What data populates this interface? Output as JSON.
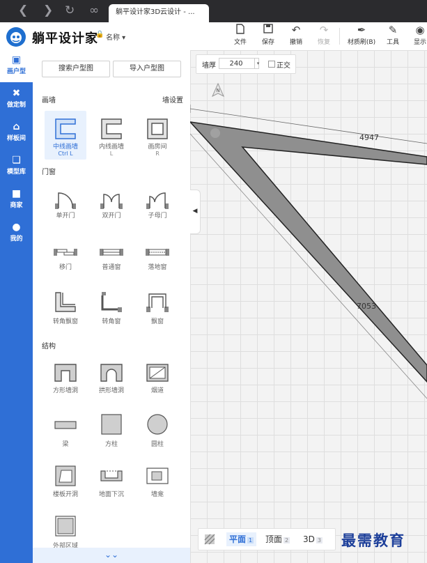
{
  "browser": {
    "tab_title": "躺平设计家3D云设计 - ...",
    "nav_icons": [
      "back-icon",
      "forward-icon",
      "reload-icon",
      "link-icon"
    ]
  },
  "header": {
    "logo_text": "躺平设计家",
    "doc_name": "名称 ▾",
    "tools": [
      {
        "label": "文件",
        "icon": "file-icon"
      },
      {
        "label": "保存",
        "icon": "save-icon"
      },
      {
        "label": "撤销",
        "icon": "undo-icon"
      },
      {
        "label": "恢复",
        "icon": "redo-icon",
        "disabled": true
      },
      {
        "label": "材质刷(B)",
        "icon": "material-brush-icon"
      },
      {
        "label": "工具",
        "icon": "tools-icon"
      },
      {
        "label": "显示",
        "icon": "eye-icon"
      }
    ]
  },
  "sidebar": {
    "items": [
      {
        "label": "画户型",
        "icon": "floorplan-icon",
        "active": true
      },
      {
        "label": "做定制",
        "icon": "customize-icon"
      },
      {
        "label": "样板间",
        "icon": "home-icon"
      },
      {
        "label": "模型库",
        "icon": "cube-icon"
      },
      {
        "label": "商家",
        "icon": "shop-icon"
      },
      {
        "label": "我的",
        "icon": "user-icon"
      }
    ]
  },
  "panel": {
    "search_button": "搜索户型图",
    "import_button": "导入户型图",
    "wall_section": "画墙",
    "wall_settings": "墙设置",
    "walls": [
      {
        "label": "中线画墙",
        "shortcut": "Ctrl L",
        "icon": "centerline-wall-icon",
        "selected": true
      },
      {
        "label": "内线画墙",
        "shortcut": "L",
        "icon": "innerline-wall-icon"
      },
      {
        "label": "画房间",
        "shortcut": "R",
        "icon": "draw-room-icon"
      }
    ],
    "door_section": "门窗",
    "doors": [
      {
        "label": "单开门",
        "icon": "single-door-icon"
      },
      {
        "label": "双开门",
        "icon": "double-door-icon"
      },
      {
        "label": "子母门",
        "icon": "mother-child-door-icon"
      },
      {
        "label": "移门",
        "icon": "sliding-door-icon"
      },
      {
        "label": "普通窗",
        "icon": "window-icon"
      },
      {
        "label": "落地窗",
        "icon": "french-window-icon"
      },
      {
        "label": "转角飘窗",
        "icon": "corner-bay-window-icon"
      },
      {
        "label": "转角窗",
        "icon": "corner-window-icon"
      },
      {
        "label": "飘窗",
        "icon": "bay-window-icon"
      }
    ],
    "structure_section": "结构",
    "structures": [
      {
        "label": "方形墙洞",
        "icon": "square-opening-icon"
      },
      {
        "label": "拱形墙洞",
        "icon": "arch-opening-icon"
      },
      {
        "label": "烟道",
        "icon": "flue-icon"
      },
      {
        "label": "梁",
        "icon": "beam-icon"
      },
      {
        "label": "方柱",
        "icon": "square-column-icon"
      },
      {
        "label": "圆柱",
        "icon": "round-column-icon"
      },
      {
        "label": "楼板开洞",
        "icon": "floor-opening-icon"
      },
      {
        "label": "地面下沉",
        "icon": "floor-sink-icon"
      },
      {
        "label": "墙龛",
        "icon": "niche-icon"
      },
      {
        "label": "外部区域",
        "icon": "outer-area-icon"
      }
    ]
  },
  "canvas": {
    "thickness_label": "墙厚",
    "thickness_value": "240",
    "ortho_label": "正交",
    "compass_letter": "N",
    "dim_top": "4947",
    "dim_left": "7053"
  },
  "viewbar": {
    "tabs": [
      {
        "label": "平面",
        "num": "1",
        "active": true
      },
      {
        "label": "顶面",
        "num": "2"
      },
      {
        "label": "3D",
        "num": "3"
      }
    ]
  },
  "watermark": "最需教育"
}
